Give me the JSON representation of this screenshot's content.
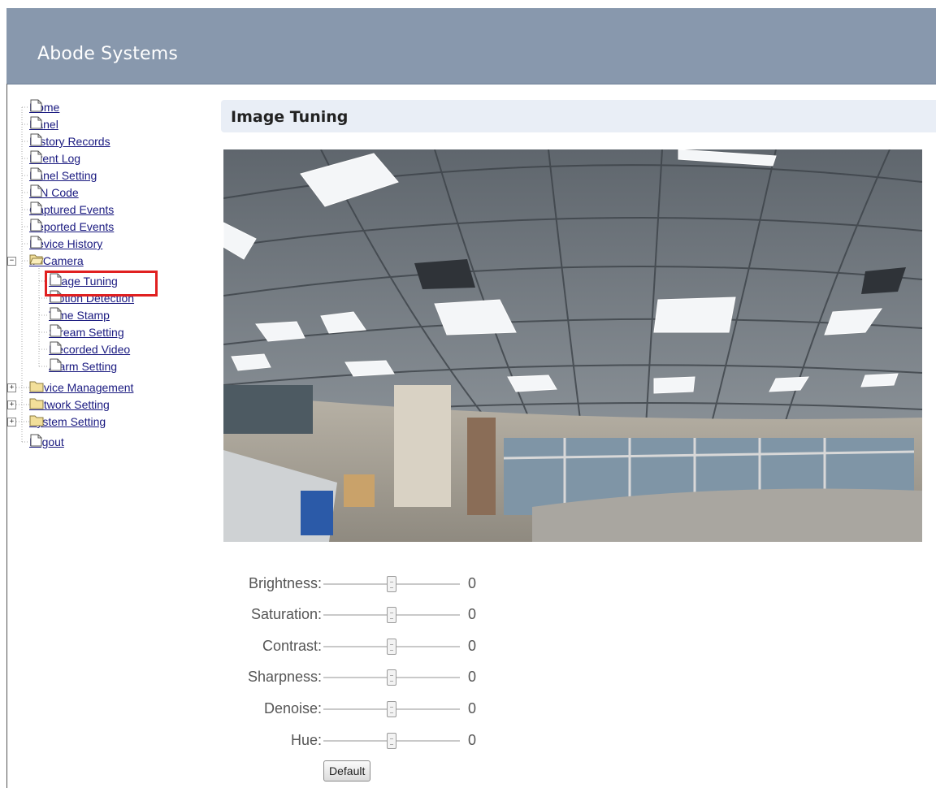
{
  "header": {
    "brand": "Abode Systems",
    "background": "#8898ad"
  },
  "sidebar": {
    "items": [
      {
        "label": "Home",
        "icon": "page-icon"
      },
      {
        "label": "Panel",
        "icon": "page-icon"
      },
      {
        "label": "History Records",
        "icon": "page-icon"
      },
      {
        "label": "Event Log",
        "icon": "page-icon"
      },
      {
        "label": "Panel Setting",
        "icon": "page-icon"
      },
      {
        "label": "PIN Code",
        "icon": "page-icon"
      },
      {
        "label": "Captured Events",
        "icon": "page-icon"
      },
      {
        "label": "Reported Events",
        "icon": "page-icon"
      },
      {
        "label": "Device History",
        "icon": "page-icon"
      },
      {
        "label": "IP Camera",
        "icon": "folder-open-icon",
        "expanded": true,
        "children": [
          {
            "label": "Image Tuning",
            "icon": "page-icon",
            "selected": true
          },
          {
            "label": "Motion Detection",
            "icon": "page-icon"
          },
          {
            "label": "Time Stamp",
            "icon": "page-icon"
          },
          {
            "label": "Stream Setting",
            "icon": "page-icon"
          },
          {
            "label": "Recorded Video",
            "icon": "page-icon"
          },
          {
            "label": "Alarm Setting",
            "icon": "page-icon"
          }
        ]
      },
      {
        "label": "Device Management",
        "icon": "folder-icon",
        "expanded": false
      },
      {
        "label": "Network Setting",
        "icon": "folder-icon",
        "expanded": false
      },
      {
        "label": "System Setting",
        "icon": "folder-icon",
        "expanded": false
      },
      {
        "label": "Logout",
        "icon": "page-icon"
      }
    ],
    "highlight_color": "#e02020"
  },
  "main": {
    "title": "Image Tuning",
    "sliders": [
      {
        "label": "Brightness:",
        "value": "0",
        "position": 0.5
      },
      {
        "label": "Saturation:",
        "value": "0",
        "position": 0.5
      },
      {
        "label": "Contrast:",
        "value": "0",
        "position": 0.5
      },
      {
        "label": "Sharpness:",
        "value": "0",
        "position": 0.5
      },
      {
        "label": "Denoise:",
        "value": "0",
        "position": 0.5
      },
      {
        "label": "Hue:",
        "value": "0",
        "position": 0.5
      }
    ],
    "default_label": "Default"
  }
}
